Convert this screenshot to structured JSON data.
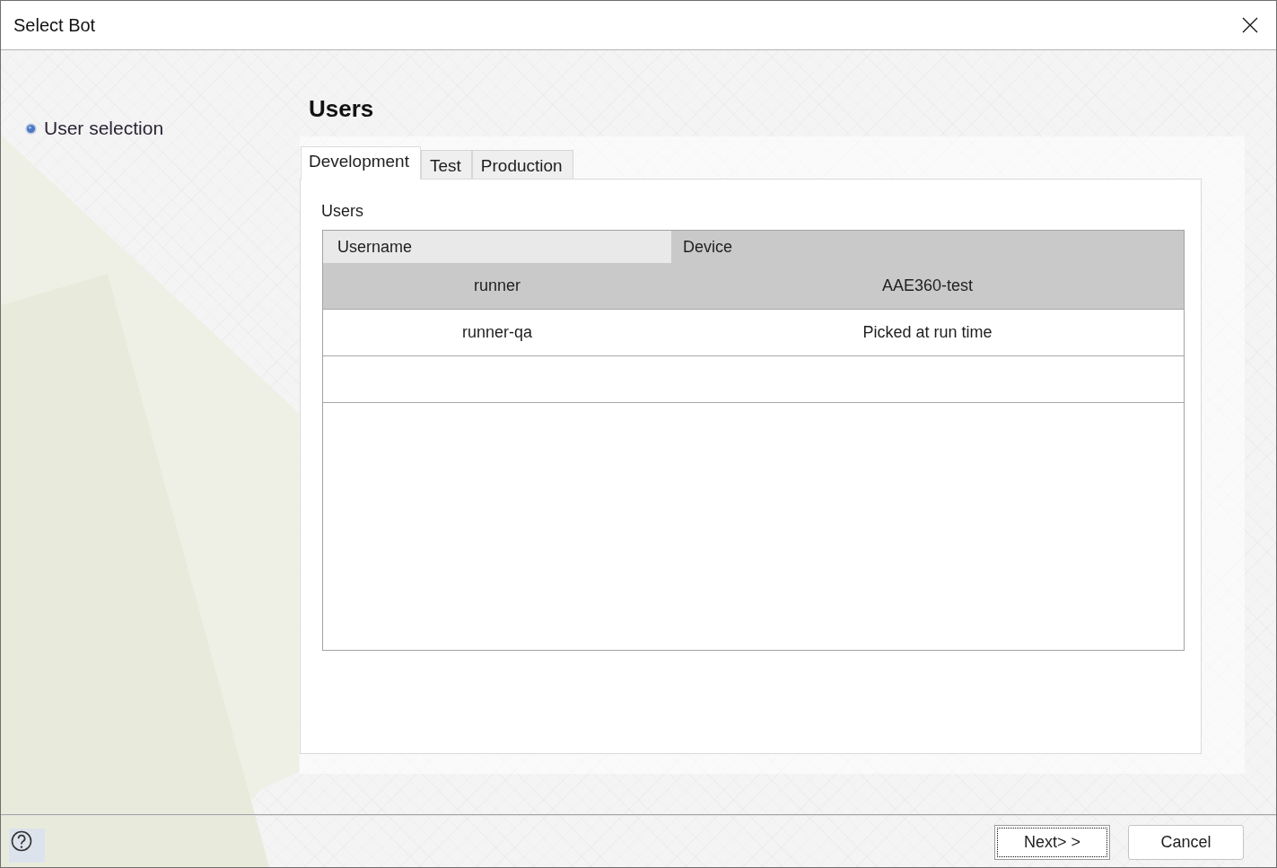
{
  "window": {
    "title": "Select Bot"
  },
  "steps": [
    {
      "label": "User selection"
    }
  ],
  "heading": "Users",
  "tabs": [
    {
      "label": "Development",
      "selected": true
    },
    {
      "label": "Test",
      "selected": false
    },
    {
      "label": "Production",
      "selected": false
    }
  ],
  "users_section": {
    "label": "Users",
    "table": {
      "columns": [
        {
          "label": "Username",
          "highlighted": false
        },
        {
          "label": "Device",
          "highlighted": true
        }
      ],
      "rows": [
        {
          "selected": true,
          "cells": [
            "runner",
            "AAE360-test"
          ]
        },
        {
          "selected": false,
          "cells": [
            "runner-qa",
            "Picked at run time"
          ]
        }
      ]
    }
  },
  "buttons": [
    {
      "label": "Next> >",
      "focused": true
    },
    {
      "label": "Cancel",
      "focused": false
    }
  ]
}
